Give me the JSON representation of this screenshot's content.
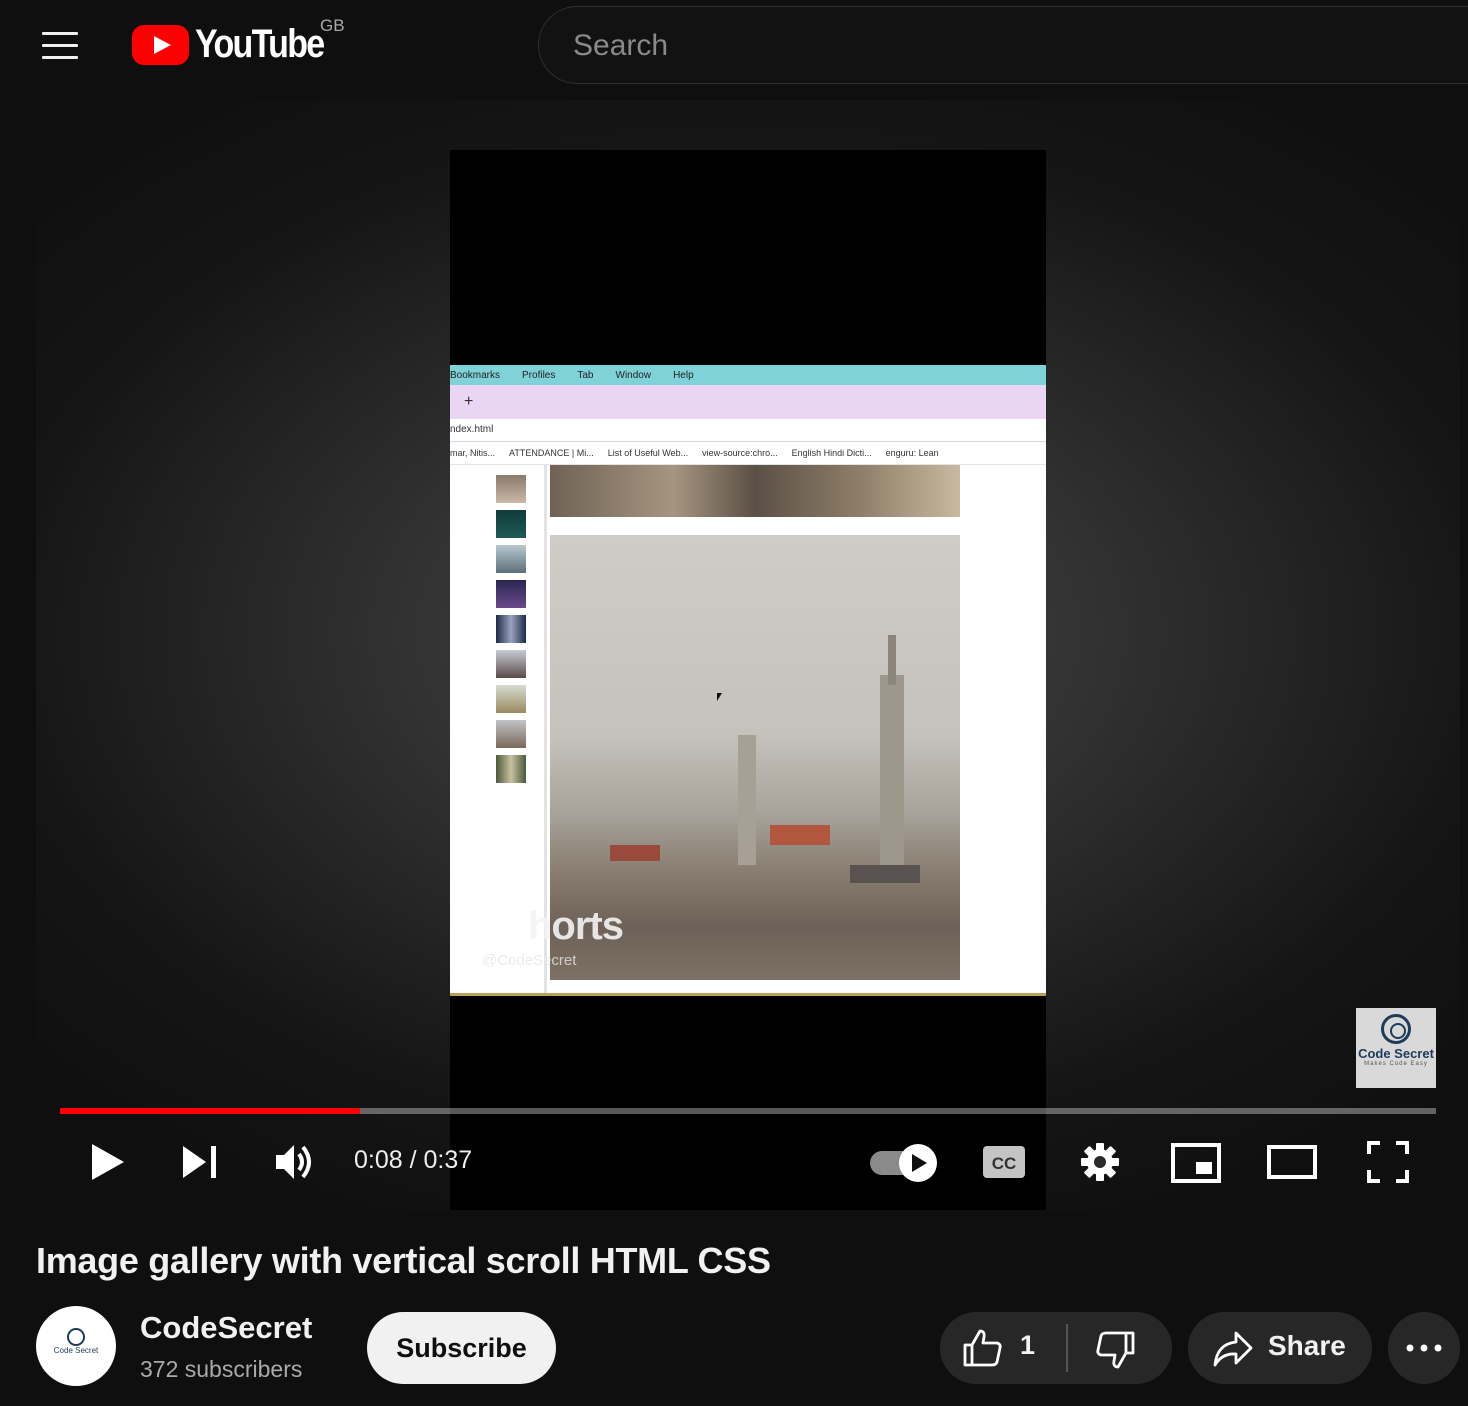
{
  "header": {
    "logo_text": "YouTube",
    "region": "GB",
    "search_placeholder": "Search"
  },
  "player": {
    "time_current": "0:08",
    "time_separator": " / ",
    "time_total": "0:37",
    "progress_fraction": 0.218,
    "autoplay_on": true,
    "cc_label": "CC",
    "video_screen": {
      "menubar": [
        "Bookmarks",
        "Profiles",
        "Tab",
        "Window",
        "Help"
      ],
      "tab_plus": "+",
      "url": "ndex.html",
      "bookmarks": [
        "mar, Nitis...",
        "ATTENDANCE | Mi...",
        "List of Useful Web...",
        "view-source:chro...",
        "English Hindi Dicti...",
        "enguru: Lean"
      ],
      "watermark_shorts": "horts",
      "watermark_handle": "@CodeSecret"
    },
    "brand_badge": {
      "title": "Code Secret",
      "tagline": "Makes Code Easy"
    }
  },
  "video": {
    "title": "Image gallery with vertical scroll HTML CSS"
  },
  "channel": {
    "name": "CodeSecret",
    "subscribers": "372 subscribers",
    "avatar_text": "Code Secret",
    "subscribe_label": "Subscribe"
  },
  "actions": {
    "like_count": "1",
    "share_label": "Share"
  },
  "colors": {
    "background": "#0f0f0f",
    "brand_red": "#ff0000",
    "pill": "#272727"
  }
}
